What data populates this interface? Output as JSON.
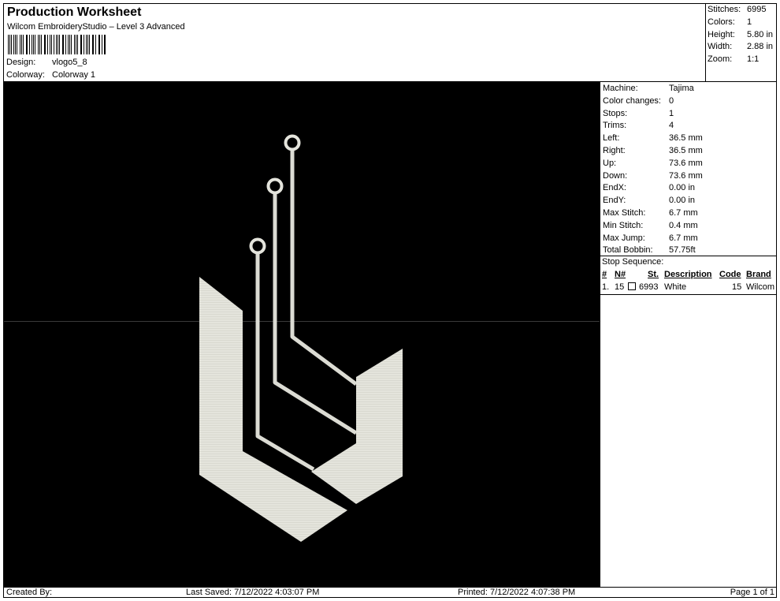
{
  "header": {
    "title": "Production Worksheet",
    "subtitle": "Wilcom EmbroideryStudio – Level 3 Advanced",
    "design_label": "Design:",
    "design_value": "vlogo5_8",
    "colorway_label": "Colorway:",
    "colorway_value": "Colorway 1"
  },
  "summary": {
    "stitches_label": "Stitches:",
    "stitches_value": "6995",
    "colors_label": "Colors:",
    "colors_value": "1",
    "height_label": "Height:",
    "height_value": "5.80 in",
    "width_label": "Width:",
    "width_value": "2.88 in",
    "zoom_label": "Zoom:",
    "zoom_value": "1:1"
  },
  "info": {
    "rows": [
      {
        "label": "Machine:",
        "value": "Tajima"
      },
      {
        "label": "Color changes:",
        "value": "0"
      },
      {
        "label": "Stops:",
        "value": "1"
      },
      {
        "label": "Trims:",
        "value": "4"
      },
      {
        "label": "Left:",
        "value": "36.5 mm"
      },
      {
        "label": "Right:",
        "value": "36.5 mm"
      },
      {
        "label": "Up:",
        "value": "73.6 mm"
      },
      {
        "label": "Down:",
        "value": "73.6 mm"
      },
      {
        "label": "EndX:",
        "value": "0.00 in"
      },
      {
        "label": "EndY:",
        "value": "0.00 in"
      },
      {
        "label": "Max Stitch:",
        "value": "6.7 mm"
      },
      {
        "label": "Min Stitch:",
        "value": "0.4 mm"
      },
      {
        "label": "Max Jump:",
        "value": "6.7 mm"
      },
      {
        "label": "Total Bobbin:",
        "value": "57.75ft"
      }
    ],
    "stop_sequence_label": "Stop Sequence:",
    "columns": {
      "num": "#",
      "needle": "N#",
      "stitches": "St.",
      "description": "Description",
      "code": "Code",
      "brand": "Brand"
    },
    "stops": [
      {
        "num": "1.",
        "needle": "15",
        "stitches": "6993",
        "description": "White",
        "code": "15",
        "brand": "Wilcom"
      }
    ]
  },
  "design": {
    "thread_color": "#e8e8e0",
    "background_color": "#000000"
  },
  "footer": {
    "created_by": "Created By:",
    "last_saved": "Last Saved: 7/12/2022 4:03:07 PM",
    "printed": "Printed: 7/12/2022 4:07:38 PM",
    "page": "Page 1 of 1"
  }
}
